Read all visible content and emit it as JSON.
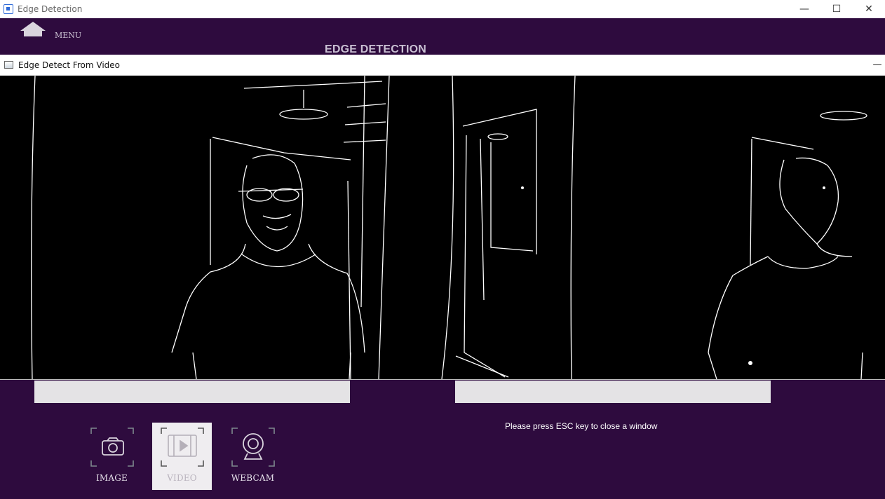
{
  "window": {
    "title": "Edge Detection",
    "controls": {
      "minimize": "—",
      "maximize": "☐",
      "close": "✕"
    }
  },
  "header": {
    "menu_label": "MENU",
    "title": "EDGE DETECTION",
    "home_icon": "home-icon"
  },
  "video_window": {
    "title": "Edge Detect From Video",
    "minimize": "—"
  },
  "hint": "Please press ESC key to close a window",
  "modes": [
    {
      "label": "IMAGE",
      "icon": "camera-icon",
      "active": false
    },
    {
      "label": "VIDEO",
      "icon": "video-icon",
      "active": true
    },
    {
      "label": "WEBCAM",
      "icon": "webcam-icon",
      "active": false
    }
  ],
  "colors": {
    "background": "#2e0b3e",
    "slot": "#e4e3e5",
    "active_button": "#efedf0"
  }
}
